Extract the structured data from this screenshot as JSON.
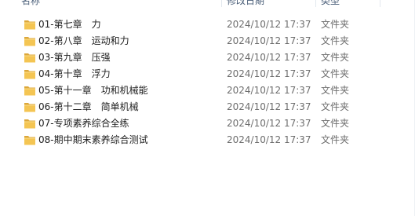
{
  "columns": {
    "name": "名称",
    "date": "修改日期",
    "type": "类型"
  },
  "rows": [
    {
      "name": "01-第七章　力",
      "date": "2024/10/12 17:37",
      "type": "文件夹",
      "icon": "folder-icon"
    },
    {
      "name": "02-第八章　运动和力",
      "date": "2024/10/12 17:37",
      "type": "文件夹",
      "icon": "folder-icon"
    },
    {
      "name": "03-第九章　压强",
      "date": "2024/10/12 17:37",
      "type": "文件夹",
      "icon": "folder-icon"
    },
    {
      "name": "04-第十章　浮力",
      "date": "2024/10/12 17:37",
      "type": "文件夹",
      "icon": "folder-icon"
    },
    {
      "name": "05-第十一章　功和机械能",
      "date": "2024/10/12 17:37",
      "type": "文件夹",
      "icon": "folder-icon"
    },
    {
      "name": "06-第十二章　简单机械",
      "date": "2024/10/12 17:37",
      "type": "文件夹",
      "icon": "folder-icon"
    },
    {
      "name": "07-专项素养综合全练",
      "date": "2024/10/12 17:37",
      "type": "文件夹",
      "icon": "folder-icon"
    },
    {
      "name": "08-期中期末素养综合测试",
      "date": "2024/10/12 17:37",
      "type": "文件夹",
      "icon": "folder-icon"
    }
  ],
  "colors": {
    "folder_front": "#f4c553",
    "folder_back": "#dca73a",
    "header_text": "#4c607a",
    "meta_text": "#6d6d6d"
  }
}
